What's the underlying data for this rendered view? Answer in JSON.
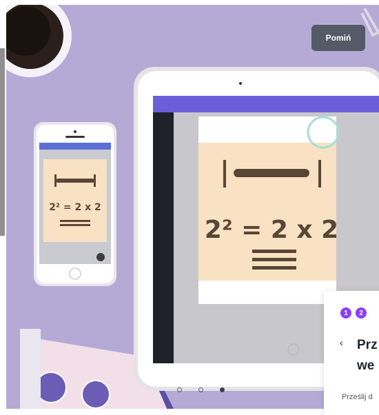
{
  "skip_button": {
    "label": "Pomiń"
  },
  "carousel": {
    "total": 3,
    "active_index": 2
  },
  "card": {
    "steps": [
      "1",
      "2"
    ],
    "title_line1": "Prz",
    "title_line2": "we",
    "description": "Prześlij d"
  },
  "artwork": {
    "tablet_equation": "2² = 2 x 2",
    "phone_equation": "2² = 2 x 2"
  },
  "colors": {
    "background": "#b5aad6",
    "accent": "#8b3dff",
    "skip_bg": "#545a66"
  }
}
